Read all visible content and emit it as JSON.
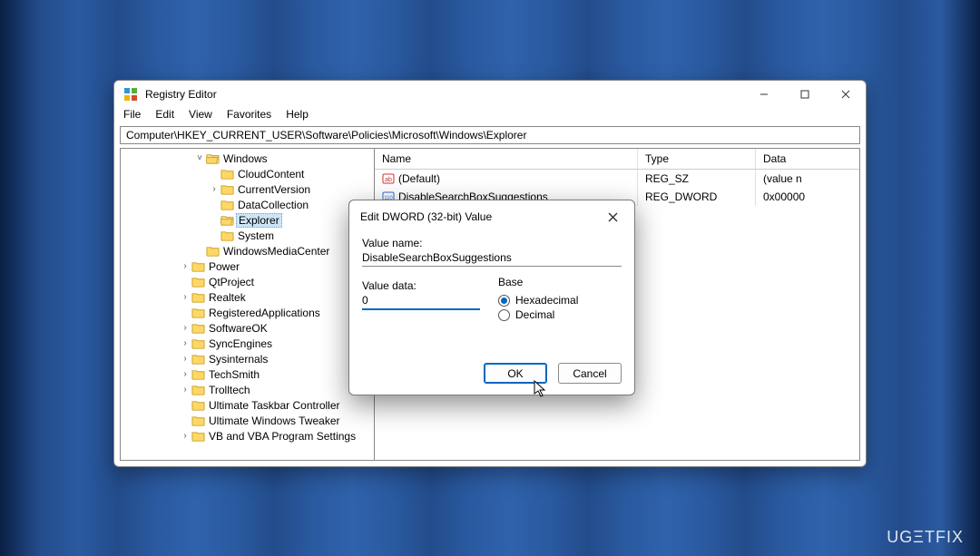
{
  "window": {
    "title": "Registry Editor",
    "menu": [
      "File",
      "Edit",
      "View",
      "Favorites",
      "Help"
    ],
    "address": "Computer\\HKEY_CURRENT_USER\\Software\\Policies\\Microsoft\\Windows\\Explorer"
  },
  "columns": {
    "name": "Name",
    "type": "Type",
    "data": "Data"
  },
  "values": [
    {
      "name": "(Default)",
      "type": "REG_SZ",
      "data": "(value n",
      "icon": "string"
    },
    {
      "name": "DisableSearchBoxSuggestions",
      "type": "REG_DWORD",
      "data": "0x00000",
      "icon": "dword"
    }
  ],
  "tree": {
    "expander_open": "˅",
    "expander_closed": "›",
    "items": [
      {
        "label": "Windows",
        "depth": 5,
        "open": true,
        "exp": "open"
      },
      {
        "label": "CloudContent",
        "depth": 6,
        "open": false,
        "exp": "none"
      },
      {
        "label": "CurrentVersion",
        "depth": 6,
        "open": false,
        "exp": "closed"
      },
      {
        "label": "DataCollection",
        "depth": 6,
        "open": false,
        "exp": "none"
      },
      {
        "label": "Explorer",
        "depth": 6,
        "open": true,
        "exp": "none",
        "selected": true
      },
      {
        "label": "System",
        "depth": 6,
        "open": false,
        "exp": "none"
      },
      {
        "label": "WindowsMediaCenter",
        "depth": 5,
        "open": false,
        "exp": "none"
      },
      {
        "label": "Power",
        "depth": 4,
        "open": false,
        "exp": "closed"
      },
      {
        "label": "QtProject",
        "depth": 4,
        "open": false,
        "exp": "none"
      },
      {
        "label": "Realtek",
        "depth": 4,
        "open": false,
        "exp": "closed"
      },
      {
        "label": "RegisteredApplications",
        "depth": 4,
        "open": false,
        "exp": "none"
      },
      {
        "label": "SoftwareOK",
        "depth": 4,
        "open": false,
        "exp": "closed"
      },
      {
        "label": "SyncEngines",
        "depth": 4,
        "open": false,
        "exp": "closed"
      },
      {
        "label": "Sysinternals",
        "depth": 4,
        "open": false,
        "exp": "closed"
      },
      {
        "label": "TechSmith",
        "depth": 4,
        "open": false,
        "exp": "closed"
      },
      {
        "label": "Trolltech",
        "depth": 4,
        "open": false,
        "exp": "closed"
      },
      {
        "label": "Ultimate Taskbar Controller",
        "depth": 4,
        "open": false,
        "exp": "none"
      },
      {
        "label": "Ultimate Windows Tweaker",
        "depth": 4,
        "open": false,
        "exp": "none"
      },
      {
        "label": "VB and VBA Program Settings",
        "depth": 4,
        "open": false,
        "exp": "closed"
      }
    ]
  },
  "dialog": {
    "title": "Edit DWORD (32-bit) Value",
    "value_name_label": "Value name:",
    "value_name": "DisableSearchBoxSuggestions",
    "value_data_label": "Value data:",
    "value_data": "0",
    "base_label": "Base",
    "hex_label": "Hexadecimal",
    "dec_label": "Decimal",
    "base_selected": "hex",
    "ok": "OK",
    "cancel": "Cancel"
  },
  "watermark": "UGΞTFIX"
}
